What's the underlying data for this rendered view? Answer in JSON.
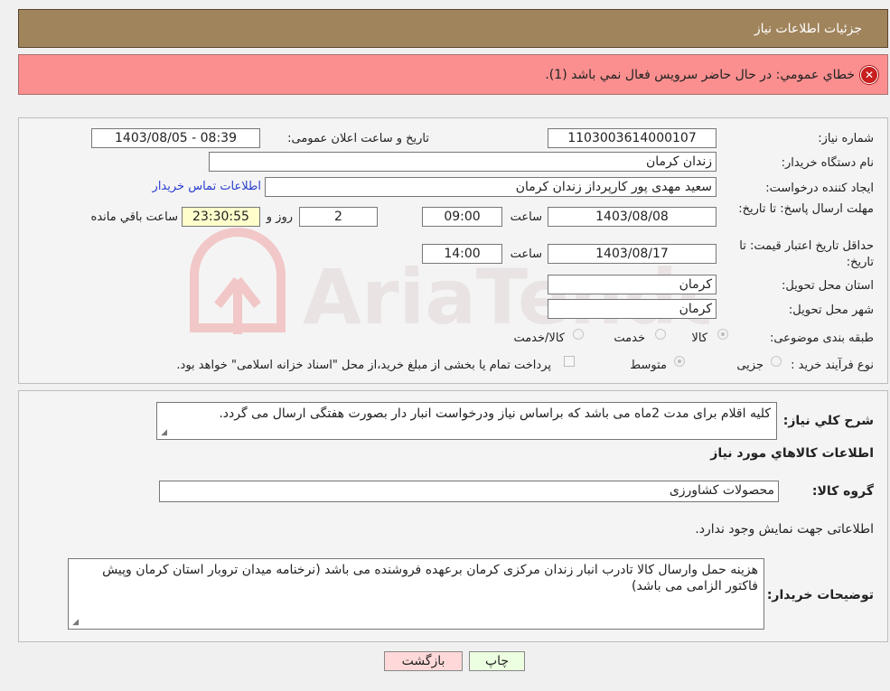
{
  "header": {
    "title": "جزئیات اطلاعات نیاز"
  },
  "alert": {
    "icon": "error-icon",
    "message": "خطاي عمومي: در حال حاضر سرويس فعال نمي باشد (1)."
  },
  "watermark": {
    "text": "AriaTender.neT"
  },
  "details": {
    "need_number_label": "شماره نیاز:",
    "need_number": "1103003614000107",
    "announce_label": "تاریخ و ساعت اعلان عمومی:",
    "announce_value": "1403/08/05 - 08:39",
    "buyer_label": "نام دستگاه خریدار:",
    "buyer_value": "زندان کرمان",
    "creator_label": "ایجاد کننده درخواست:",
    "creator_value": "سعید مهدی پور کارپرداز زندان کرمان",
    "contact_link": "اطلاعات تماس خریدار",
    "deadline_label": "مهلت ارسال پاسخ: تا تاریخ:",
    "deadline_date": "1403/08/08",
    "time_label": "ساعت",
    "deadline_time": "09:00",
    "days_value": "2",
    "days_label": "روز و",
    "remaining_time": "23:30:55",
    "remaining_label": "ساعت باقي مانده",
    "validity_label": "حداقل تاریخ اعتبار قیمت: تا تاریخ:",
    "validity_date": "1403/08/17",
    "validity_time": "14:00",
    "province_label": "استان محل تحویل:",
    "province_value": "کرمان",
    "city_label": "شهر محل تحویل:",
    "city_value": "کرمان",
    "category_label": "طبقه بندی موضوعی:",
    "category_options": [
      "کالا",
      "خدمت",
      "کالا/خدمت"
    ],
    "category_selected": "کالا",
    "process_label": "نوع فرآیند خرید :",
    "process_options": [
      "جزیی",
      "متوسط"
    ],
    "process_selected": "متوسط",
    "payment_note": "پرداخت تمام یا بخشی از مبلغ خرید،از محل \"اسناد خزانه اسلامی\" خواهد بود."
  },
  "goods": {
    "summary_label": "شرح کلي نياز:",
    "summary_value": "کلیه اقلام برای مدت 2ماه می باشد که براساس نیاز ودرخواست انبار دار بصورت هفتگی ارسال می گردد.",
    "section_title": "اطلاعات کالاهاي مورد نياز",
    "group_label": "گروه کالا:",
    "group_value": "محصولات کشاورزی",
    "no_info": "اطلاعاتی جهت نمایش وجود ندارد.",
    "buyer_notes_label": "توضیحات خریدار:",
    "buyer_notes_value": "هزینه حمل وارسال کالا تادرب انبار زندان مرکزی کرمان برعهده فروشنده می باشد (نرخنامه میدان تروبار استان کرمان وپیش فاکتور الزامی می باشد)"
  },
  "actions": {
    "print_label": "چاپ",
    "back_label": "بازگشت"
  },
  "colors": {
    "header": "#a0845c",
    "alert": "#fb8f8f",
    "print_btn": "#ecffe0",
    "back_btn": "#ffd9d9"
  }
}
